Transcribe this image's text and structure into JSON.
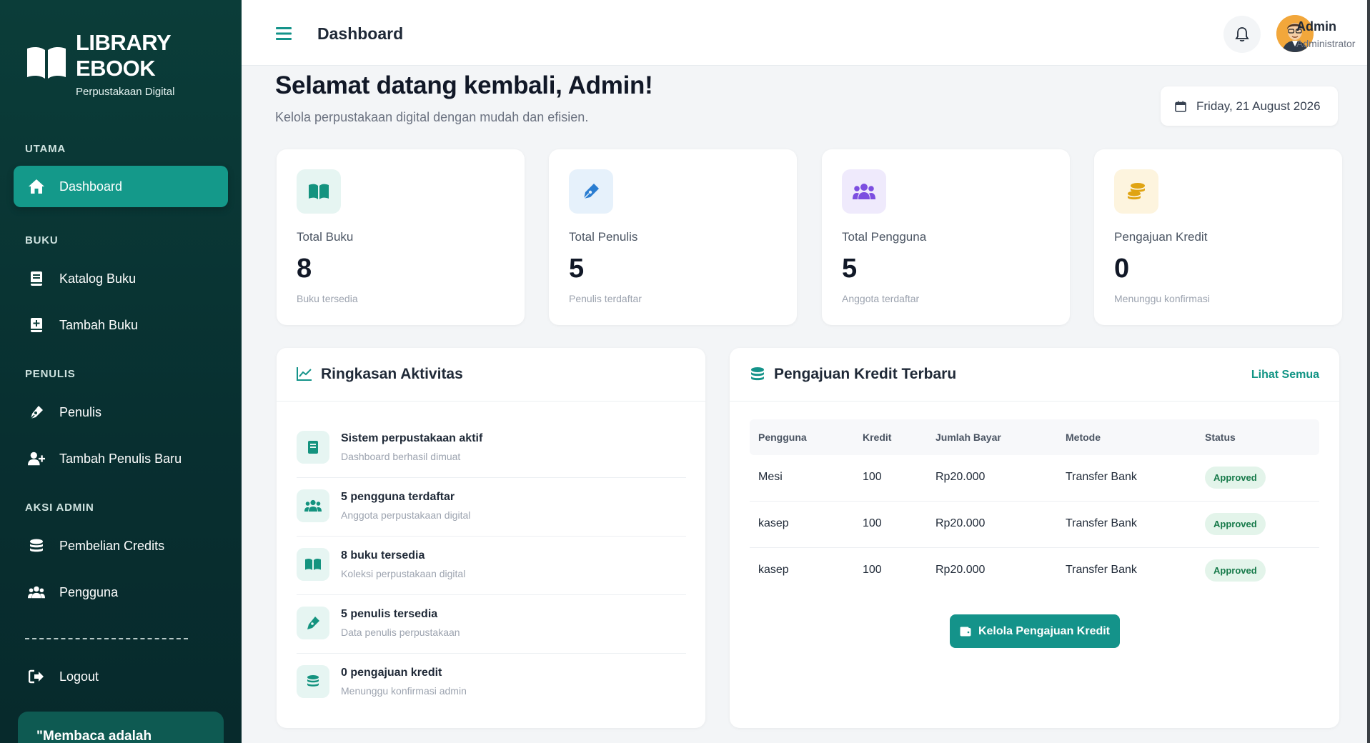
{
  "brand": {
    "title_line1": "LIBRARY",
    "title_line2": "EBOOK",
    "subtitle": "Perpustakaan Digital"
  },
  "sidebar": {
    "sections": {
      "utama": "UTAMA",
      "buku": "BUKU",
      "penulis": "PENULIS",
      "aksi_admin": "AKSI ADMIN"
    },
    "items": {
      "dashboard": {
        "label": "Dashboard",
        "icon": "home-icon",
        "active": true
      },
      "katalog": {
        "label": "Katalog Buku",
        "icon": "book-icon"
      },
      "tambah_buku": {
        "label": "Tambah Buku",
        "icon": "book-plus-icon"
      },
      "penulis": {
        "label": "Penulis",
        "icon": "pen-icon"
      },
      "tambah_penulis": {
        "label": "Tambah Penulis Baru",
        "icon": "user-plus-icon"
      },
      "pembelian": {
        "label": "Pembelian Credits",
        "icon": "coins-icon"
      },
      "pengguna": {
        "label": "Pengguna",
        "icon": "users-icon"
      },
      "logout": {
        "label": "Logout",
        "icon": "logout-icon"
      }
    },
    "quote": "\"Membaca adalah"
  },
  "topbar": {
    "title": "Dashboard",
    "user_name": "Admin",
    "user_role": "Administrator"
  },
  "welcome": {
    "title": "Selamat datang kembali, Admin!",
    "subtitle": "Kelola perpustakaan digital dengan mudah dan efisien.",
    "date": "Friday, 21 August 2026"
  },
  "stats": [
    {
      "label": "Total Buku",
      "value": "8",
      "hint": "Buku tersedia",
      "icon": "book-open-icon",
      "bg": "#e6f5f2",
      "fg": "#14937f"
    },
    {
      "label": "Total Penulis",
      "value": "5",
      "hint": "Penulis terdaftar",
      "icon": "pen-nib-icon",
      "bg": "#e6f1fb",
      "fg": "#2a7dd1"
    },
    {
      "label": "Total Pengguna",
      "value": "5",
      "hint": "Anggota terdaftar",
      "icon": "users-icon",
      "bg": "#efeafc",
      "fg": "#7c4ee0"
    },
    {
      "label": "Pengajuan Kredit",
      "value": "0",
      "hint": "Menunggu konfirmasi",
      "icon": "coins-icon",
      "bg": "#fdf4de",
      "fg": "#e0a413"
    }
  ],
  "activity": {
    "title": "Ringkasan Aktivitas",
    "items": [
      {
        "title": "Sistem perpustakaan aktif",
        "desc": "Dashboard berhasil dimuat",
        "icon": "book-icon"
      },
      {
        "title": "5 pengguna terdaftar",
        "desc": "Anggota perpustakaan digital",
        "icon": "users-icon"
      },
      {
        "title": "8 buku tersedia",
        "desc": "Koleksi perpustakaan digital",
        "icon": "book-open-icon"
      },
      {
        "title": "5 penulis tersedia",
        "desc": "Data penulis perpustakaan",
        "icon": "pen-icon"
      },
      {
        "title": "0 pengajuan kredit",
        "desc": "Menunggu konfirmasi admin",
        "icon": "coins-icon"
      }
    ]
  },
  "credits": {
    "title": "Pengajuan Kredit Terbaru",
    "view_all": "Lihat Semua",
    "columns": [
      "Pengguna",
      "Kredit",
      "Jumlah Bayar",
      "Metode",
      "Status"
    ],
    "rows": [
      {
        "user": "Mesi",
        "kredit": "100",
        "jumlah": "Rp20.000",
        "metode": "Transfer Bank",
        "status": "Approved"
      },
      {
        "user": "kasep",
        "kredit": "100",
        "jumlah": "Rp20.000",
        "metode": "Transfer Bank",
        "status": "Approved"
      },
      {
        "user": "kasep",
        "kredit": "100",
        "jumlah": "Rp20.000",
        "metode": "Transfer Bank",
        "status": "Approved"
      }
    ],
    "cta": "Kelola Pengajuan Kredit"
  },
  "colors": {
    "primary": "#14938a",
    "sidebar_bg": "#0b3d39",
    "approved_bg": "#e3f4ea",
    "approved_fg": "#177a4a"
  }
}
